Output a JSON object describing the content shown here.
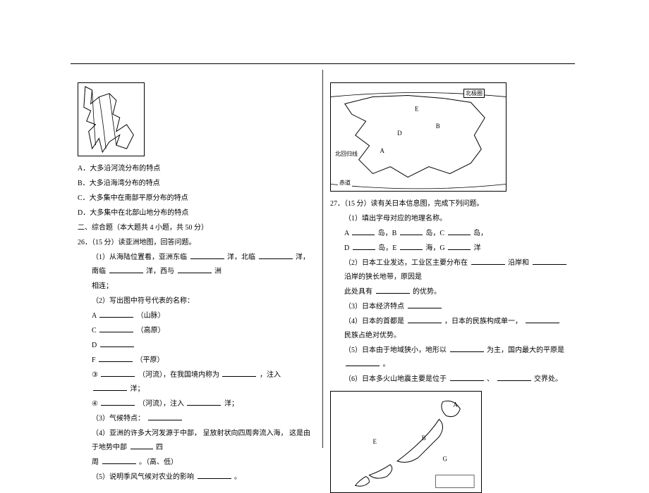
{
  "left": {
    "optA": "A．大多沿河流分布的特点",
    "optB": "B．大多沿海湾分布的特点",
    "optC": "C．大多集中在南部平原分布的特点",
    "optD": "D．大多集中在北部山地分布的特点",
    "section": "二、综合题（本大题共    4 小题，共  50 分）",
    "q26": "26．（15 分）读亚洲地图，回答问题。",
    "q26_1a": "（1）从海陆位置看，亚洲东临",
    "q26_1b": "洋，北临",
    "q26_1c": "洋，南临",
    "q26_1d": "洋，西与",
    "q26_1e": "洲",
    "q26_1f": "相连；",
    "q26_2": "（2）写出图中符号代表的名称：",
    "q26_A": "A",
    "q26_A_suf": "（山脉）",
    "q26_C": "C",
    "q26_C_suf": "（高原）",
    "q26_D": "D",
    "q26_F": "F",
    "q26_F_suf": "（平原）",
    "q26_3a": "③",
    "q26_3b": "（河流），在我国境内称为",
    "q26_3c": "，注入",
    "q26_3d": "洋；",
    "q26_4a": "④",
    "q26_4b": "（河流），注入",
    "q26_4c": "洋；",
    "q26_3_clim": "（3）气候特点：",
    "q26_4_riv_a": "（4）亚洲的许多大河发源于中部，   呈放射状向四周奔流入海，   这是由于地势中部",
    "q26_4_riv_b": "四",
    "q26_4_riv_c": "周",
    "q26_4_riv_d": "。（高、低）",
    "q26_5a": "（5）说明季风气候对农业的影响",
    "q26_5b": "。"
  },
  "right": {
    "map_label1": "北极圈",
    "map_label2": "北回归线",
    "map_label3": "赤道",
    "q27": "27．（15 分）读有关日本信息图，完成下列问题。",
    "q27_1": "（1）填出字母对应的地理名称。",
    "q27_A": "A",
    "q27_A_suf": "岛，B",
    "q27_B_suf": "岛，C",
    "q27_C_suf": "岛，",
    "q27_D": "D",
    "q27_D_suf": "岛，E",
    "q27_E_suf": "海，G",
    "q27_G_suf": "洋",
    "q27_2a": "（2）日本工业发达，工业区主要分布在",
    "q27_2b": "沿岸和",
    "q27_2c": "沿岸的狭长地带，原因是",
    "q27_2d": "此处具有",
    "q27_2e": "的优势。",
    "q27_3": "（3）日本经济特点",
    "q27_4a": "（4）日本的首都是",
    "q27_4b": "，日本的民族构成单一，",
    "q27_4c": "民族占绝对优势。",
    "q27_5a": "（5）日本由于地域狭小，地形以",
    "q27_5b": "为主，国内最大的平原是",
    "q27_5c": "。",
    "q27_6a": "（6）日本多火山地震主要是位于",
    "q27_6b": "、",
    "q27_6c": "交界处。"
  }
}
